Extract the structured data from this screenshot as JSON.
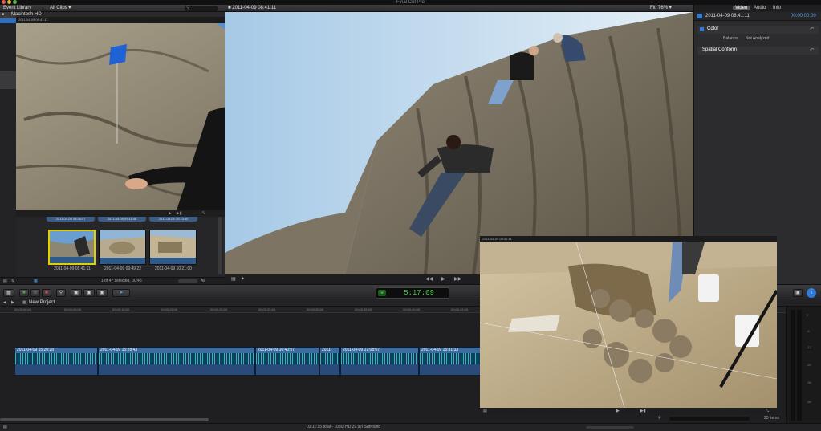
{
  "app": {
    "title": "Final Cut Pro"
  },
  "colors": {
    "accent": "#2f7bdc",
    "selection": "#e0d000",
    "timecode": "#46d246",
    "clip": "#3d6c9e"
  },
  "event_library": {
    "title": "Event Library",
    "filter": "All Clips",
    "drive": "Macintosh HD",
    "event": "2011-04-09 08:41:11"
  },
  "browser": {
    "clips": [
      {
        "label": "2011-04-09 08:41:11"
      },
      {
        "label": "2011-04-09 09:49:22"
      },
      {
        "label": "2011-04-09 10:21:00"
      }
    ],
    "top_clips": [
      "2011-04-09 08:36:57",
      "2011-04-09 09:11:48",
      "2011-04-09 10:13:30"
    ],
    "status": "1 of 47 selected, 00:46",
    "all": "All"
  },
  "viewer": {
    "clip": "2011-04-09 08:41:11",
    "fit_label": "Fit:",
    "fit_value": "76%"
  },
  "inspector": {
    "tabs": [
      "Video",
      "Audio",
      "Info"
    ],
    "clip": "2011-04-09 08:41:11",
    "timecode": "00:00:00:00",
    "color_section": "Color",
    "balance_label": "Balance:",
    "balance_value": "Not Analyzed",
    "spatial_section": "Spatial Conform"
  },
  "toolbar": {
    "timecode": "5:17:09",
    "timecode_label": "HR"
  },
  "timeline": {
    "project": "New Project",
    "ruler": [
      "00:00:00:00",
      "00:00:05:00",
      "00:00:10:00",
      "00:00:15:00",
      "00:00:20:00",
      "00:00:25:00",
      "00:00:30:00",
      "00:00:35:00",
      "00:00:40:00",
      "00:00:45:00"
    ],
    "clips": [
      {
        "title": "2011-04-09 15:20:28"
      },
      {
        "title": "2011-04-09 15:28:43"
      },
      {
        "title": "2011-04-09 16:40:07"
      },
      {
        "title": "2011-"
      },
      {
        "title": "2011-04-09 17:08:07"
      },
      {
        "title": "2011-04-09 15:31:33"
      }
    ],
    "status": "03:11:15 total - 1080i HD 29.97i Surround",
    "items": "25 items"
  },
  "meters": [
    "0",
    "-6",
    "-12",
    "-20",
    "-30",
    "-50"
  ],
  "overlay_small": {
    "clip": "2011-04-09 08:41:11"
  },
  "overlay_dig": {
    "clip": "2011-04-09 08:41:11"
  }
}
